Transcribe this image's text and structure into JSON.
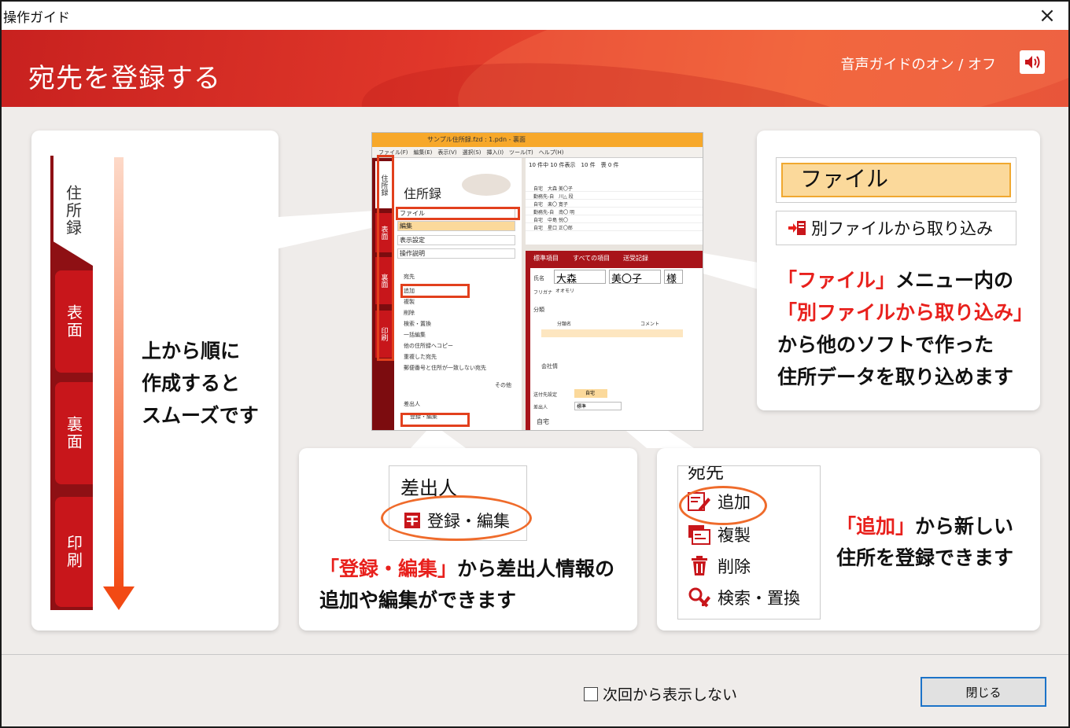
{
  "window": {
    "title": "操作ガイド",
    "close_icon": "×"
  },
  "banner": {
    "title": "宛先を登録する",
    "voice_toggle_label": "音声ガイドのオン / オフ"
  },
  "left_panel": {
    "tabs": [
      "住所録",
      "表面",
      "裏面",
      "印刷"
    ],
    "lines": [
      "上から順に",
      "作成すると",
      "スムーズです"
    ]
  },
  "screenshot": {
    "titlebar": "サンプル住所録.fzd : 1.pdn - 裏面",
    "menubar": "ファイル(F)　編集(E)　表示(V)　選択(S)　挿入(I)　ツール(T)　ヘルプ(H)",
    "side_tabs": [
      "住所録",
      "表面",
      "裏面",
      "印刷"
    ],
    "panel_title": "住所録",
    "menu_items": [
      "ファイル",
      "編集",
      "表示設定",
      "操作説明"
    ],
    "dest_label": "宛先",
    "dest_items": [
      "追加",
      "複製",
      "削除",
      "検索・置換",
      "一括編集",
      "他の住所録へコピー",
      "重複した宛先",
      "郵便番号と住所が一致しない宛先"
    ],
    "more_label": "その他",
    "sender_label": "差出人",
    "sender_item": "登録・編集",
    "grid_header": "10 件中 10 件表示　10 件　喪 0 件",
    "grid_rows": [
      "自宅　大森 美〇子",
      "勤務先-自　川△ 段",
      "自宅　楽〇 寛子",
      "勤務先-自　南〇 明",
      "自宅　中島 悦〇",
      "自宅　星口 正〇郎"
    ],
    "form_tabs": [
      "標準項目",
      "すべての項目",
      "送受記録"
    ],
    "form_name_label": "氏名",
    "form_last": "大森",
    "form_first": "美〇子",
    "form_honorific": "様",
    "form_kana_label": "フリガナ",
    "form_kana": "オオモリ",
    "form_group_label": "分類",
    "form_group_col1": "分類名",
    "form_group_col2": "コメント",
    "form_company_label": "会社情",
    "form_dest_setting": "送付先設定",
    "form_home": "自宅",
    "form_sender_label": "差出人",
    "form_standard": "標準",
    "form_home2": "自宅"
  },
  "right_top": {
    "file_menu": "ファイル",
    "import_item": "別ファイルから取り込み",
    "line1_red": "「ファイル」",
    "line1_rest": "メニュー内の",
    "line2_red": "「別ファイルから取り込み」",
    "line3": "から他のソフトで作った",
    "line4": "住所データを取り込めます"
  },
  "bottom_mid": {
    "sender_label": "差出人",
    "sender_item": "登録・編集",
    "line1_red": "「登録・編集」",
    "line1_rest": "から差出人情報の",
    "line2": "追加や編集ができます"
  },
  "bottom_right": {
    "dest_label": "宛先",
    "items": [
      "追加",
      "複製",
      "削除",
      "検索・置換"
    ],
    "line1_red": "「追加」",
    "line1_rest": "から新しい",
    "line2": "住所を登録できます"
  },
  "footer": {
    "dont_show_label": "次回から表示しない",
    "close_label": "閉じる"
  },
  "colors": {
    "banner_red": "#d92b23",
    "accent_red": "#e8201c",
    "tab_red": "#c8161b",
    "arrow_orange": "#f24a14"
  }
}
